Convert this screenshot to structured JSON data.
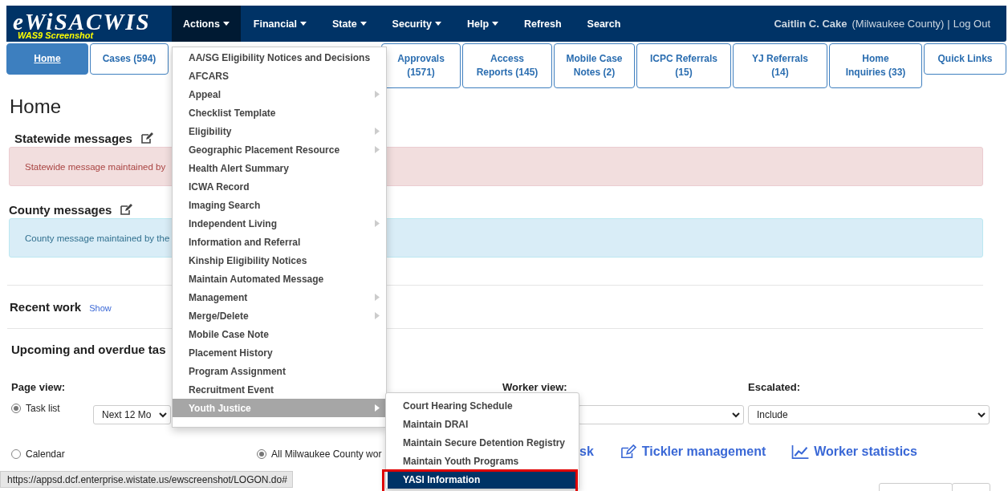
{
  "navbar": {
    "logo": "eWiSACWIS",
    "logo_subtitle": "WAS9 Screenshot",
    "menus": [
      {
        "label": "Actions",
        "dropdown": true,
        "selected": true
      },
      {
        "label": "Financial",
        "dropdown": true,
        "selected": false
      },
      {
        "label": "State",
        "dropdown": true,
        "selected": false
      },
      {
        "label": "Security",
        "dropdown": true,
        "selected": false
      },
      {
        "label": "Help",
        "dropdown": true,
        "selected": false
      },
      {
        "label": "Refresh",
        "dropdown": false,
        "selected": false
      },
      {
        "label": "Search",
        "dropdown": false,
        "selected": false
      }
    ],
    "user": "Caitlin C. Cake",
    "county": "(Milwaukee County)",
    "separator": "|",
    "logout": "Log Out"
  },
  "tabs": [
    {
      "lines": [
        "Home"
      ],
      "selected": true
    },
    {
      "lines": [
        "Cases (594)"
      ],
      "selected": false
    },
    {
      "lines": [
        "Approvals",
        "(1571)"
      ],
      "selected": false
    },
    {
      "lines": [
        "Access",
        "Reports (145)"
      ],
      "selected": false
    },
    {
      "lines": [
        "Mobile Case",
        "Notes (2)"
      ],
      "selected": false
    },
    {
      "lines": [
        "ICPC Referrals",
        "(15)"
      ],
      "selected": false
    },
    {
      "lines": [
        "YJ Referrals",
        "(14)"
      ],
      "selected": false
    },
    {
      "lines": [
        "Home",
        "Inquiries (33)"
      ],
      "selected": false
    },
    {
      "lines": [
        "Quick Links"
      ],
      "selected": false
    }
  ],
  "page_title": "Home",
  "statewide": {
    "heading": "Statewide messages",
    "message": "Statewide message maintained by"
  },
  "county": {
    "heading": "County messages",
    "message": "County message maintained by the"
  },
  "recent_work": {
    "heading": "Recent work",
    "link": "Show"
  },
  "tasks": {
    "heading": "Upcoming and overdue tas",
    "page_view": {
      "label": "Page view:",
      "options": [
        {
          "label": "Task list",
          "selected": true
        },
        {
          "label": "Calendar",
          "selected": false
        }
      ],
      "range": "Next 12 Mo"
    },
    "worker_view": {
      "label": "Worker view:",
      "option": {
        "label": "All Milwaukee County wor",
        "selected": true
      }
    },
    "escalated": {
      "label": "Escalated:",
      "value": "Include"
    },
    "links": [
      {
        "label": "sk"
      },
      {
        "label": "Tickler management"
      },
      {
        "label": "Worker statistics"
      }
    ]
  },
  "actions_menu": [
    {
      "label": "AA/SG Eligibility Notices and Decisions",
      "submenu": false,
      "highlighted": false
    },
    {
      "label": "AFCARS",
      "submenu": false,
      "highlighted": false
    },
    {
      "label": "Appeal",
      "submenu": true,
      "highlighted": false
    },
    {
      "label": "Checklist Template",
      "submenu": false,
      "highlighted": false
    },
    {
      "label": "Eligibility",
      "submenu": true,
      "highlighted": false
    },
    {
      "label": "Geographic Placement Resource",
      "submenu": true,
      "highlighted": false
    },
    {
      "label": "Health Alert Summary",
      "submenu": false,
      "highlighted": false
    },
    {
      "label": "ICWA Record",
      "submenu": false,
      "highlighted": false
    },
    {
      "label": "Imaging Search",
      "submenu": false,
      "highlighted": false
    },
    {
      "label": "Independent Living",
      "submenu": true,
      "highlighted": false
    },
    {
      "label": "Information and Referral",
      "submenu": false,
      "highlighted": false
    },
    {
      "label": "Kinship Eligibility Notices",
      "submenu": false,
      "highlighted": false
    },
    {
      "label": "Maintain Automated Message",
      "submenu": false,
      "highlighted": false
    },
    {
      "label": "Management",
      "submenu": true,
      "highlighted": false
    },
    {
      "label": "Merge/Delete",
      "submenu": true,
      "highlighted": false
    },
    {
      "label": "Mobile Case Note",
      "submenu": false,
      "highlighted": false
    },
    {
      "label": "Placement History",
      "submenu": false,
      "highlighted": false
    },
    {
      "label": "Program Assignment",
      "submenu": false,
      "highlighted": false
    },
    {
      "label": "Recruitment Event",
      "submenu": false,
      "highlighted": false
    },
    {
      "label": "Youth Justice",
      "submenu": true,
      "highlighted": true
    }
  ],
  "youth_justice_menu": [
    {
      "label": "Court Hearing Schedule",
      "selected": false
    },
    {
      "label": "Maintain DRAI",
      "selected": false
    },
    {
      "label": "Maintain Secure Detention Registry",
      "selected": false
    },
    {
      "label": "Maintain Youth Programs",
      "selected": false
    },
    {
      "label": "YASI Information",
      "selected": true
    }
  ],
  "status_url": "https://appsd.dcf.enterprise.wistate.us/ewscreenshot/LOGON.do#"
}
